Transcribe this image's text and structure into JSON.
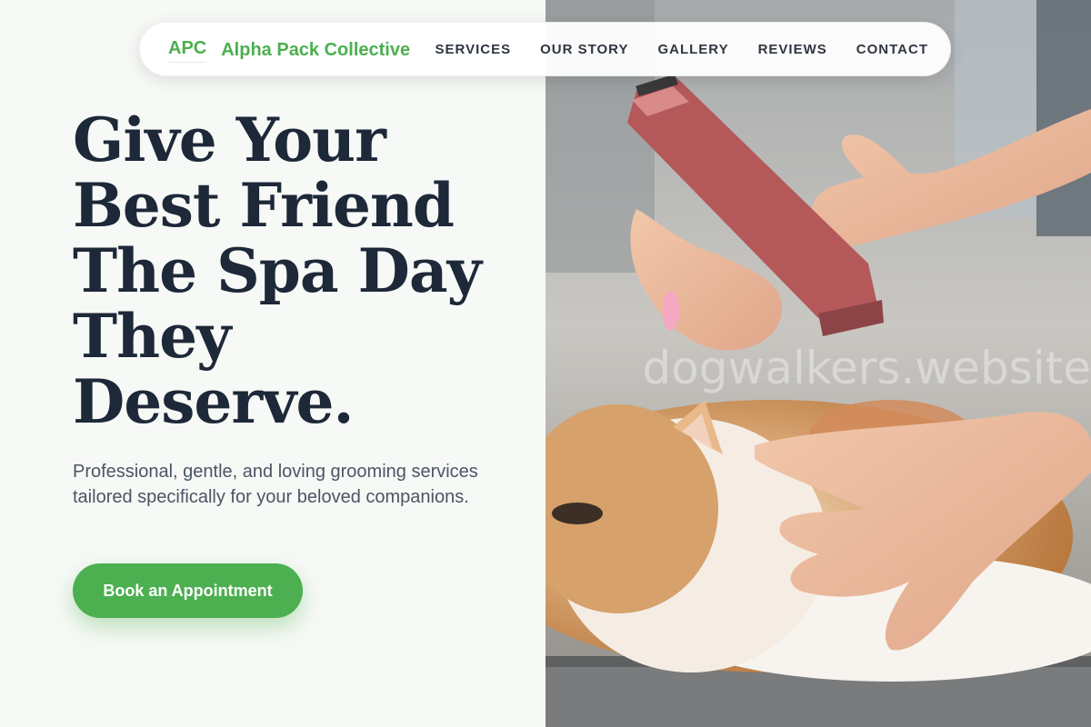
{
  "nav": {
    "logo_mark": "APC",
    "brand_name": "Alpha Pack Collective",
    "links": [
      {
        "label": "SERVICES"
      },
      {
        "label": "OUR STORY"
      },
      {
        "label": "GALLERY"
      },
      {
        "label": "REVIEWS"
      },
      {
        "label": "CONTACT"
      }
    ]
  },
  "hero": {
    "title_lines": [
      "Give Your",
      "Best Friend",
      "The Spa Day",
      "They",
      "Deserve."
    ],
    "subtitle": "Professional, gentle, and loving grooming services tailored specifically for your beloved companions.",
    "cta_label": "Book an Appointment",
    "image": {
      "subject": "persian-cat-being-groomed-with-clippers-photo",
      "watermark": "dogwalkers.website"
    }
  },
  "colors": {
    "accent": "#4caf50",
    "heading": "#1d2838",
    "body_text": "#4b5563",
    "background": "#f7f9f6"
  }
}
